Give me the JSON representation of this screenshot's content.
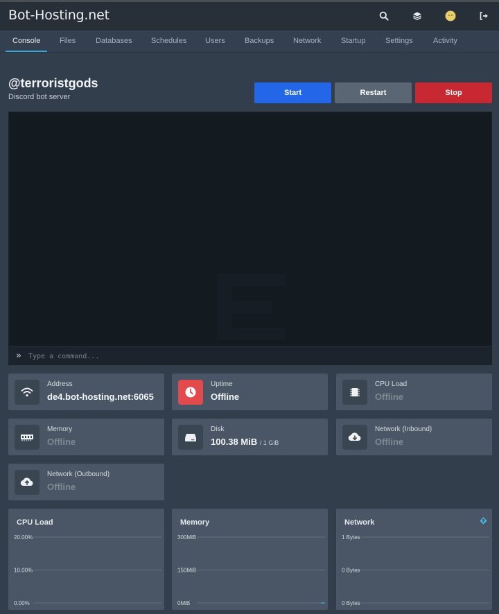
{
  "header": {
    "brand": "Bot-Hosting.net",
    "icons": [
      "search-icon",
      "layers-icon",
      "avatar",
      "logout-icon"
    ]
  },
  "tabs": [
    {
      "label": "Console",
      "active": true
    },
    {
      "label": "Files"
    },
    {
      "label": "Databases"
    },
    {
      "label": "Schedules"
    },
    {
      "label": "Users"
    },
    {
      "label": "Backups"
    },
    {
      "label": "Network"
    },
    {
      "label": "Startup"
    },
    {
      "label": "Settings"
    },
    {
      "label": "Activity"
    }
  ],
  "server": {
    "name": "@terroristgods",
    "description": "Discord bot server"
  },
  "power": {
    "start": "Start",
    "restart": "Restart",
    "stop": "Stop"
  },
  "console": {
    "prompt": "»",
    "placeholder": "Type a command...",
    "value": ""
  },
  "stats": {
    "address": {
      "label": "Address",
      "value": "de4.bot-hosting.net:6065",
      "icon": "wifi-icon"
    },
    "uptime": {
      "label": "Uptime",
      "value": "Offline",
      "icon": "clock-icon"
    },
    "cpu": {
      "label": "CPU Load",
      "value": "Offline",
      "icon": "chip-icon"
    },
    "memory": {
      "label": "Memory",
      "value": "Offline",
      "icon": "memory-icon"
    },
    "disk": {
      "label": "Disk",
      "value": "100.38 MiB",
      "limit": "/ 1 GiB",
      "icon": "disk-icon"
    },
    "net_in": {
      "label": "Network (Inbound)",
      "value": "Offline",
      "icon": "cloud-download-icon"
    },
    "net_out": {
      "label": "Network (Outbound)",
      "value": "Offline",
      "icon": "cloud-upload-icon"
    }
  },
  "colors": {
    "accent": "#3aa6d8",
    "start": "#2466e8",
    "restart": "#5b6674",
    "stop": "#c72831",
    "uptime_alert": "#e24a4d",
    "legend_inbound": "#f2c94c",
    "legend_outbound": "#3db6e8"
  },
  "chart_data": [
    {
      "type": "line",
      "title": "CPU Load",
      "y_ticks": [
        "20.00%",
        "10.00%",
        "0.00%"
      ],
      "ylim": [
        0,
        20
      ],
      "series": [],
      "grid": true
    },
    {
      "type": "line",
      "title": "Memory",
      "y_ticks": [
        "300MiB",
        "150MiB",
        "0MiB"
      ],
      "ylim": [
        0,
        300
      ],
      "series": [],
      "grid": true
    },
    {
      "type": "line",
      "title": "Network",
      "y_ticks": [
        "1 Bytes",
        "0 Bytes",
        "0 Bytes"
      ],
      "ylim": [
        0,
        1
      ],
      "series": [],
      "grid": true,
      "legend_icons": [
        "inbound-legend-icon",
        "outbound-legend-icon"
      ]
    }
  ]
}
